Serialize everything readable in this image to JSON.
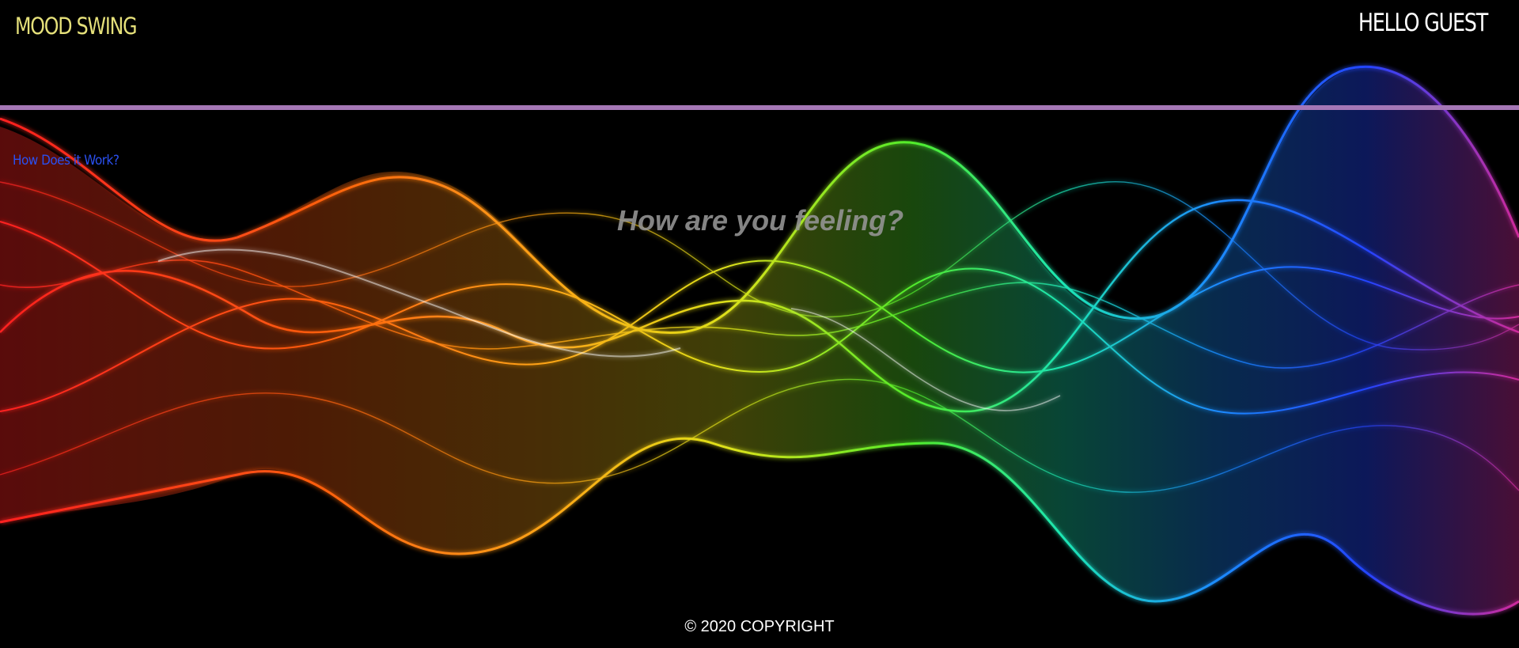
{
  "header": {
    "brand": "MOOD SWING",
    "greeting": "HELLO GUEST"
  },
  "nav": {
    "how_it_works_label": "How Does it Work?"
  },
  "main": {
    "question": "How are you feeling?"
  },
  "footer": {
    "copyright": "© 2020 COPYRIGHT"
  },
  "colors": {
    "background": "#000000",
    "brand": "#e5e07a",
    "divider": "#a577b6",
    "link": "#2b50f0",
    "question": "#969696"
  },
  "background_image": "rainbow-wave-artwork"
}
